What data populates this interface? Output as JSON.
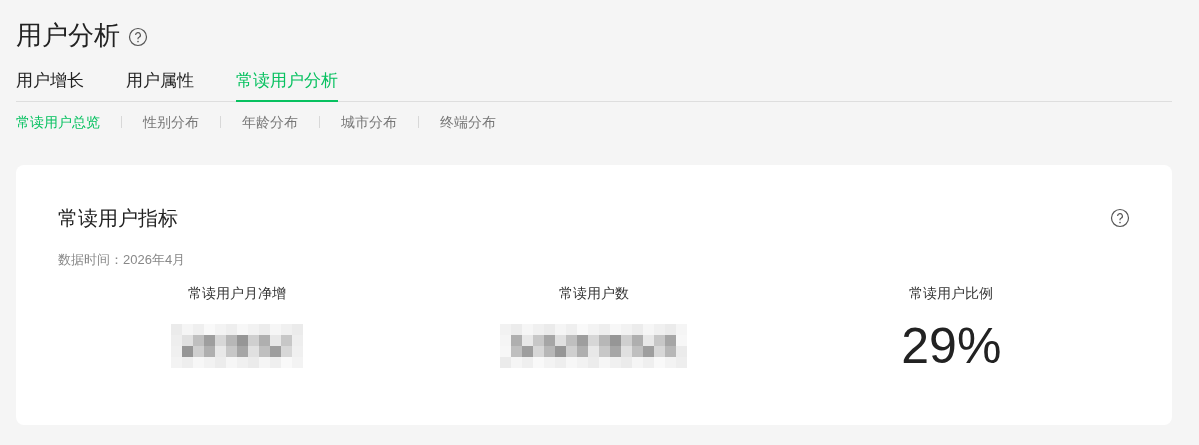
{
  "page": {
    "title": "用户分析"
  },
  "tabs": [
    {
      "label": "用户增长",
      "selected": false
    },
    {
      "label": "用户属性",
      "selected": false
    },
    {
      "label": "常读用户分析",
      "selected": true
    }
  ],
  "subtabs": [
    {
      "label": "常读用户总览",
      "selected": true
    },
    {
      "label": "性别分布",
      "selected": false
    },
    {
      "label": "年龄分布",
      "selected": false
    },
    {
      "label": "城市分布",
      "selected": false
    },
    {
      "label": "终端分布",
      "selected": false
    }
  ],
  "card": {
    "title": "常读用户指标",
    "data_time": "数据时间：2026年4月",
    "metrics": [
      {
        "label": "常读用户月净增",
        "kind": "redacted"
      },
      {
        "label": "常读用户数",
        "kind": "redacted"
      },
      {
        "label": "常读用户比例",
        "kind": "value",
        "value": "29%"
      }
    ]
  }
}
